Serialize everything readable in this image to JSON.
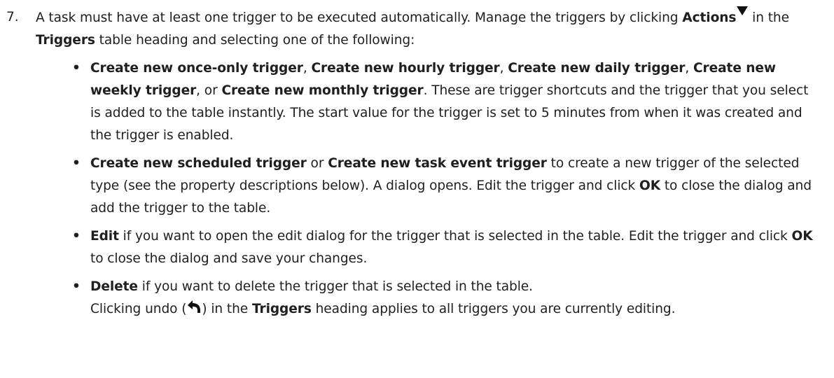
{
  "step": {
    "number": "7.",
    "intro_1": "A task must have at least one trigger to be executed automatically. Manage the triggers by clicking ",
    "actions_label": "Actions",
    "actions_icon": "triangle-down-icon",
    "intro_2": " in the ",
    "triggers_label": "Triggers",
    "intro_3": " table heading and selecting one of the following:"
  },
  "bullets": {
    "shortcuts": {
      "once": "Create new once-only trigger",
      "hourly": "Create new hourly trigger",
      "daily": "Create new daily trigger",
      "weekly": "Create new weekly trigger",
      "monthly": "Create new monthly trigger",
      "sep": ", ",
      "or": ", or ",
      "desc": ". These are trigger shortcuts and the trigger that you select is added to the table instantly. The start value for the trigger is set to 5 minutes from when it was created and the trigger is enabled."
    },
    "scheduled": {
      "scheduled": "Create new scheduled trigger",
      "or": " or ",
      "task_event": "Create new task event trigger",
      "desc_1": " to create a new trigger of the selected type (see the property descriptions below). A dialog opens. Edit the trigger and click ",
      "ok": "OK",
      "desc_2": " to close the dialog and add the trigger to the table."
    },
    "edit": {
      "label": "Edit",
      "desc_1": " if you want to open the edit dialog for the trigger that is selected in the table. Edit the trigger and click ",
      "ok": "OK",
      "desc_2": " to close the dialog and save your changes."
    },
    "delete": {
      "label": "Delete",
      "desc": " if you want to delete the trigger that is selected in the table.",
      "undo_1": "Clicking undo (",
      "undo_icon": "undo-icon",
      "undo_2": ") in the ",
      "triggers_label": "Triggers",
      "undo_3": " heading applies to all triggers you are currently editing."
    }
  }
}
